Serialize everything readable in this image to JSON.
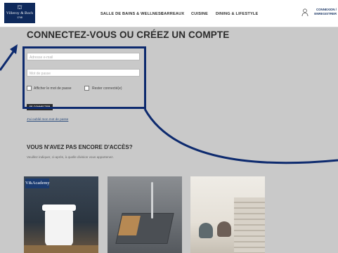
{
  "header": {
    "logo": {
      "brand": "Villeroy & Boch",
      "year": "1748"
    },
    "nav": [
      "SALLE DE BAINS & WELLNESS",
      "CARREAUX",
      "CUISINE",
      "DINING & LIFESTYLE"
    ],
    "account": {
      "line1": "CONNEXION /",
      "line2": "ENREGISTRER",
      "icon": "user-icon"
    }
  },
  "login": {
    "title": "CONNECTEZ-VOUS OU CRÉEZ UN COMPTE",
    "email_placeholder": "Adresse e-mail",
    "password_placeholder": "Mot de passe",
    "show_password_label": "Afficher le mot de passe",
    "stay_logged_label": "Rester connecté(e)",
    "submit_label": "SE CONNECTER",
    "forgot_link": "J'ai oublié mon mot de passe"
  },
  "no_access": {
    "title": "VOUS N'AVEZ PAS ENCORE D'ACCÈS?",
    "subtitle": "Veuillez indiquer, ci-après, à quelle division vous appartenez."
  },
  "cards": [
    {
      "badge": "V&Academy"
    }
  ],
  "colors": {
    "annotation": "#0d2a6e",
    "logo_bg": "#0f2a5c",
    "button_bg": "#2b2b2b",
    "page_bg": "#c9c9c9"
  }
}
